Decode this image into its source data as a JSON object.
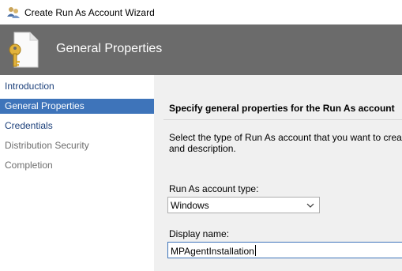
{
  "window": {
    "title": "Create Run As Account Wizard",
    "icon": "run-as-account-icon"
  },
  "header": {
    "title": "General Properties",
    "icon": "document-key-icon"
  },
  "sidebar": {
    "items": [
      {
        "label": "Introduction",
        "state": "done"
      },
      {
        "label": "General Properties",
        "state": "active"
      },
      {
        "label": "Credentials",
        "state": "done"
      },
      {
        "label": "Distribution Security",
        "state": "future"
      },
      {
        "label": "Completion",
        "state": "future"
      }
    ]
  },
  "main": {
    "heading": "Specify general properties for the Run As account",
    "description_line1": "Select the type of Run As account that you want to create,",
    "description_line2": "and description.",
    "account_type_label": "Run As account type:",
    "account_type_value": "Windows",
    "display_name_label": "Display name:",
    "display_name_value": "MPAgentInstallation"
  },
  "colors": {
    "header_band": "#6b6b6b",
    "active_nav": "#3e74ba",
    "content_bg": "#f0f0f0"
  }
}
